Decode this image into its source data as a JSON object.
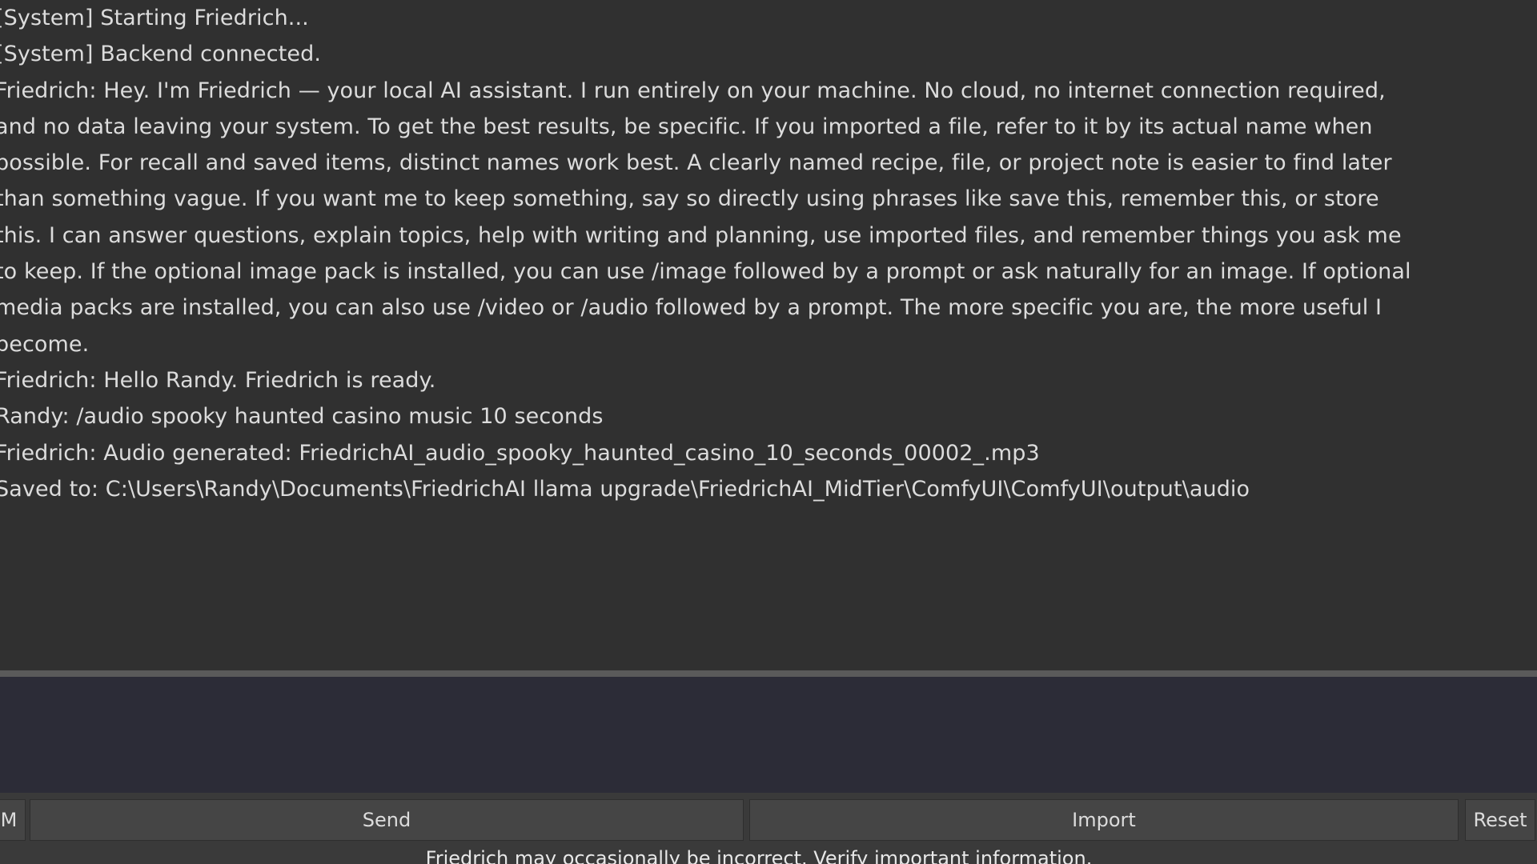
{
  "chat": {
    "lines": [
      "[System] Starting Friedrich...",
      "[System] Backend connected.",
      "Friedrich: Hey. I'm Friedrich — your local AI assistant. I run entirely on your machine. No cloud, no internet connection required,",
      "and no data leaving your system. To get the best results, be specific. If you imported a file, refer to it by its actual name when",
      "possible. For recall and saved items, distinct names work best. A clearly named recipe, file, or project note is easier to find later",
      "than something vague. If you want me to keep something, say so directly using phrases like save this, remember this, or store",
      "this. I can answer questions, explain topics, help with writing and planning, use imported files, and remember things you ask me",
      "to keep. If the optional image pack is installed, you can use /image followed by a prompt or ask naturally for an image. If optional",
      "media packs are installed, you can also use /video or /audio followed by a prompt. The more specific you are, the more useful I",
      "become.",
      "Friedrich: Hello Randy. Friedrich is ready.",
      "Randy: /audio spooky haunted casino music 10 seconds",
      "Friedrich: Audio generated: FriedrichAI_audio_spooky_haunted_casino_10_seconds_00002_.mp3",
      "Saved to: C:\\Users\\Randy\\Documents\\FriedrichAI llama upgrade\\FriedrichAI_MidTier\\ComfyUI\\ComfyUI\\output\\audio"
    ]
  },
  "input": {
    "value": ""
  },
  "buttons": {
    "left_partial_label": "M",
    "send_label": "Send",
    "import_label": "Import",
    "reset_label": "Reset"
  },
  "status": {
    "disclaimer": "Friedrich may occasionally be incorrect. Verify important information."
  },
  "colors": {
    "chat_background": "#303030",
    "input_background": "#2c2c37",
    "text": "#dcdcdc",
    "button_background": "#454545",
    "divider": "#5a5a5a"
  }
}
